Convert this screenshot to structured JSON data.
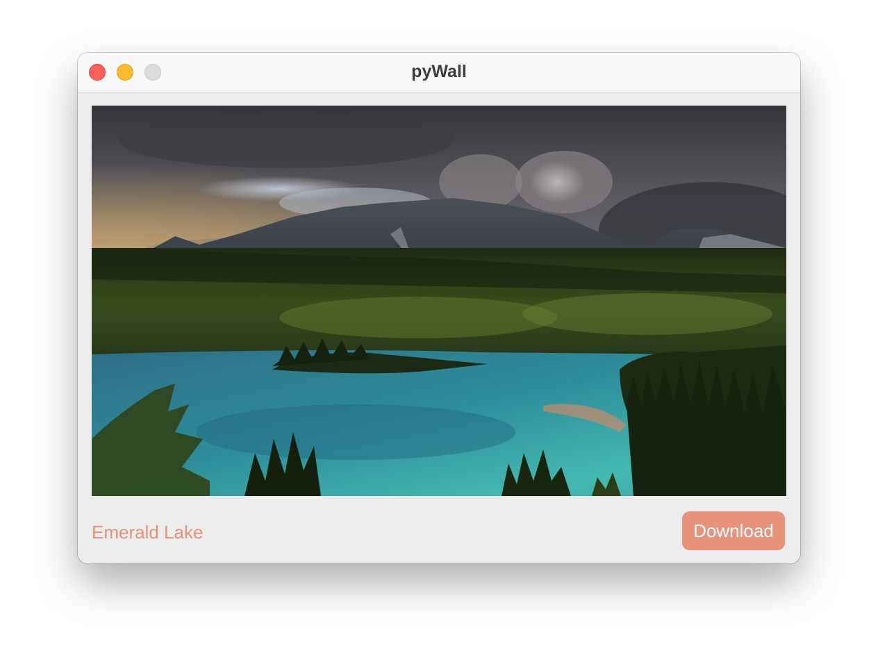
{
  "window": {
    "title": "pyWall"
  },
  "wallpaper": {
    "name": "Emerald Lake"
  },
  "actions": {
    "download_label": "Download"
  },
  "colors": {
    "accent": "#e6937a",
    "window_bg": "#ececec",
    "titlebar_bg": "#f7f7f7",
    "close": "#fe5f57",
    "minimize": "#febc2e",
    "zoom_disabled": "#dcdcdc"
  },
  "icons": {
    "close": "close-button",
    "minimize": "minimize-button",
    "zoom": "zoom-button"
  }
}
